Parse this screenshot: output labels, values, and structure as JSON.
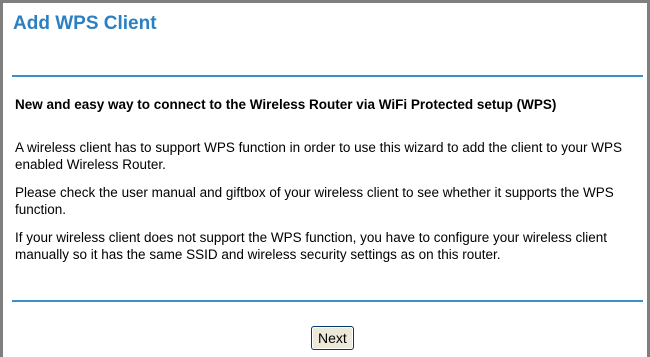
{
  "page": {
    "title": "Add WPS Client",
    "subtitle": "New and easy way to connect to the Wireless Router via WiFi Protected setup (WPS)",
    "paragraphs": [
      "A wireless client has to support WPS function in order to use this wizard to add the client to your WPS enabled Wireless Router.",
      "Please check the user manual and giftbox of your wireless client to see whether it supports the WPS function.",
      "If your wireless client does not support the WPS function, you have to configure your wireless client manually so it has the same SSID and wireless security settings as on this router."
    ]
  },
  "buttons": {
    "next_label": "Next"
  },
  "colors": {
    "title": "#2c80c2",
    "rule": "#3d8fc8",
    "border": "#7f7f7f"
  }
}
